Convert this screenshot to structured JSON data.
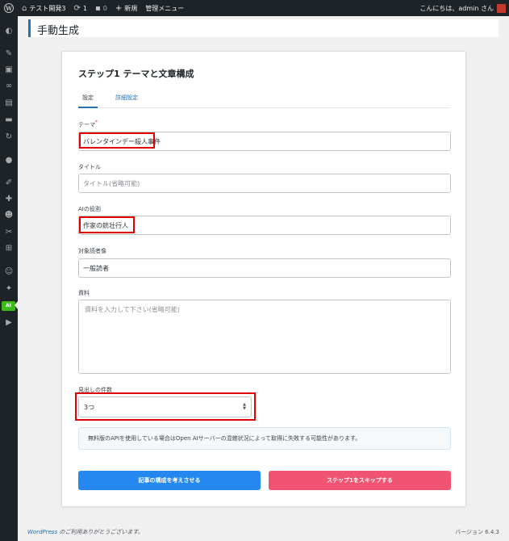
{
  "admin_bar": {
    "site_name": "テスト開発3",
    "updates_count": "1",
    "comments_count": "0",
    "new_label": "新規",
    "admin_menu_label": "管理メニュー",
    "greeting": "こんにちは、admin さん"
  },
  "sidebar": {
    "icons": [
      "dashboard-icon",
      "pin-icon",
      "media-icon",
      "link-icon",
      "pages-icon",
      "comments-icon",
      "refresh-icon",
      "drop-icon",
      "brush-icon",
      "plugin-icon",
      "users-icon",
      "tools-icon",
      "settings-icon",
      "profile-icon",
      "wrench-icon",
      "ai-plugin-icon",
      "play-icon"
    ],
    "active_label": "AI"
  },
  "page": {
    "title": "手動生成"
  },
  "card": {
    "title": "ステップ1 テーマと文章構成",
    "tabs": [
      {
        "label": "設定",
        "active": true
      },
      {
        "label": "詳細設定",
        "active": false
      }
    ],
    "fields": {
      "theme": {
        "label": "テーマ",
        "required_mark": "*",
        "value": "バレンタインデー殺人事件"
      },
      "title": {
        "label": "タイトル",
        "placeholder": "タイトル(省略可能)"
      },
      "ai_role": {
        "label": "AIの役割",
        "value": "作家の銃壮行人"
      },
      "audience": {
        "label": "対象読者像",
        "value": "一般読者"
      },
      "material": {
        "label": "資料",
        "placeholder": "資料を入力して下さい(省略可能)"
      },
      "heading_count": {
        "label": "見出しの件数",
        "value": "3つ"
      }
    },
    "notice": "無料版のAPIを使用している場合はOpen AIサーバーの混雑状況によって取得に失敗する可能性があります。",
    "buttons": {
      "primary": "記事の構成を考えさせる",
      "skip": "ステップ1をスキップする"
    }
  },
  "footer": {
    "thanks_link": "WordPress",
    "thanks_text": " のご利用ありがとうございます。",
    "version": "バージョン 6.4.3"
  },
  "colors": {
    "accent": "#2271b1",
    "primary_button": "#2488f0",
    "skip_button": "#f05472",
    "highlight": "#e00000",
    "plugin_active": "#3cba1a"
  }
}
